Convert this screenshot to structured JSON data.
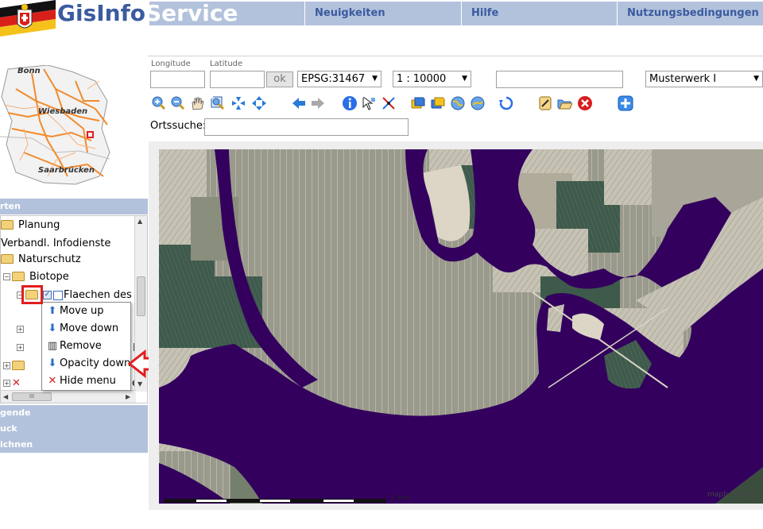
{
  "header": {
    "brand_part1": "GisInfo",
    "brand_part2": "Service",
    "nav": [
      {
        "label": "Neuigkeiten"
      },
      {
        "label": "Hilfe"
      },
      {
        "label": "Nutzungsbedingungen"
      }
    ]
  },
  "overview_map": {
    "towns": [
      "Bonn",
      "Wiesbaden",
      "Saarbrücken"
    ]
  },
  "left_panel": {
    "headers": [
      "rten",
      "gende",
      "uck",
      "ichnen"
    ],
    "tree": [
      {
        "label": "Planung"
      },
      {
        "label": "Verbandl. Infodienste"
      },
      {
        "label": "Naturschutz"
      },
      {
        "label": "Biotope"
      },
      {
        "label": "Flaechen des"
      }
    ],
    "tree_partial": [
      "n",
      "E",
      "e"
    ],
    "hscroll_grip": "III"
  },
  "context_menu": {
    "items": [
      {
        "label": "Move up",
        "icon": "arrow-up-icon"
      },
      {
        "label": "Move down",
        "icon": "arrow-down-icon"
      },
      {
        "label": "Remove",
        "icon": "trash-icon"
      },
      {
        "label": "Opacity down",
        "icon": "arrow-down-icon"
      },
      {
        "label": "Hide menu",
        "icon": "close-icon"
      }
    ]
  },
  "coords": {
    "longitude_label": "Longitude",
    "latitude_label": "Latitude",
    "longitude_value": "",
    "latitude_value": "",
    "ok_label": "ok",
    "epsg": "EPSG:31467",
    "scale": "1 : 10000",
    "free_field": "",
    "layer_select": "Musterwerk I"
  },
  "search": {
    "label": "Ortssuche:",
    "value": ""
  },
  "map": {
    "scale_label": "1 km",
    "copyright": "mapbender.org",
    "water_color": "#33005e"
  }
}
